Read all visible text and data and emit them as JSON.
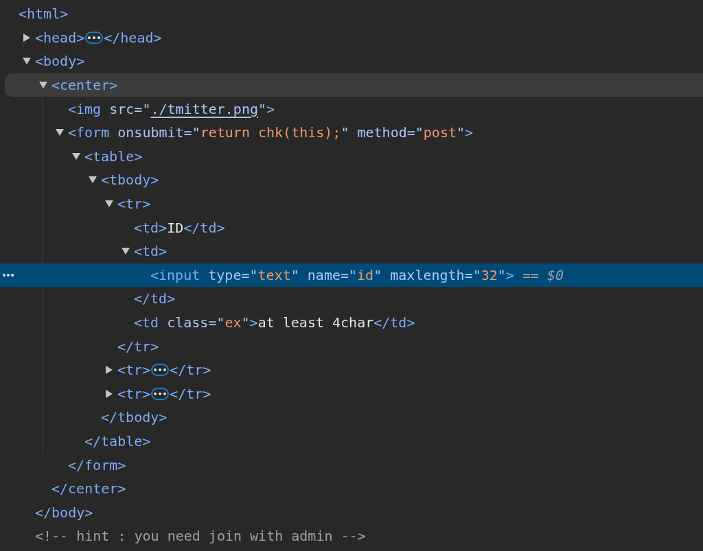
{
  "dom_tree": {
    "line": [
      {
        "kind": "tag",
        "text": "<html>"
      }
    ],
    "selected": false,
    "hovered": false,
    "children": [
      {
        "line": [
          {
            "kind": "tag",
            "text": "<head>"
          }
        ],
        "expanded": false,
        "selected": false,
        "hovered": false,
        "close": [
          {
            "kind": "tag",
            "text": "</head>"
          }
        ]
      },
      {
        "line": [
          {
            "kind": "tag",
            "text": "<body>"
          }
        ],
        "expanded": true,
        "selected": false,
        "hovered": false,
        "close": [
          {
            "kind": "tag",
            "text": "</body>"
          }
        ],
        "children": [
          {
            "line": [
              {
                "kind": "tag",
                "text": "<center>"
              }
            ],
            "expanded": true,
            "selected": false,
            "hovered": true,
            "close": [
              {
                "kind": "tag",
                "text": "</center>"
              }
            ],
            "children": [
              {
                "line": [
                  {
                    "kind": "tag",
                    "text": "<img"
                  },
                  {
                    "kind": "attr",
                    "text": " src"
                  },
                  {
                    "kind": "attr",
                    "text": "=\""
                  },
                  {
                    "kind": "link",
                    "text": "./tmitter.png"
                  },
                  {
                    "kind": "attr",
                    "text": "\""
                  },
                  {
                    "kind": "tag",
                    "text": ">"
                  }
                ],
                "selected": false,
                "hovered": false
              },
              {
                "line": [
                  {
                    "kind": "tag",
                    "text": "<form"
                  },
                  {
                    "kind": "attr",
                    "text": " onsubmit"
                  },
                  {
                    "kind": "attr",
                    "text": "=\""
                  },
                  {
                    "kind": "value",
                    "text": "return chk(this);"
                  },
                  {
                    "kind": "attr",
                    "text": "\" method"
                  },
                  {
                    "kind": "attr",
                    "text": "=\""
                  },
                  {
                    "kind": "value",
                    "text": "post"
                  },
                  {
                    "kind": "attr",
                    "text": "\""
                  },
                  {
                    "kind": "tag",
                    "text": ">"
                  }
                ],
                "expanded": true,
                "selected": false,
                "hovered": false,
                "close": [
                  {
                    "kind": "tag",
                    "text": "</form>"
                  }
                ],
                "children": [
                  {
                    "line": [
                      {
                        "kind": "tag",
                        "text": "<table>"
                      }
                    ],
                    "expanded": true,
                    "selected": false,
                    "hovered": false,
                    "close": [
                      {
                        "kind": "tag",
                        "text": "</table>"
                      }
                    ],
                    "children": [
                      {
                        "line": [
                          {
                            "kind": "tag",
                            "text": "<tbody>"
                          }
                        ],
                        "expanded": true,
                        "selected": false,
                        "hovered": false,
                        "close": [
                          {
                            "kind": "tag",
                            "text": "</tbody>"
                          }
                        ],
                        "children": [
                          {
                            "line": [
                              {
                                "kind": "tag",
                                "text": "<tr>"
                              }
                            ],
                            "expanded": true,
                            "selected": false,
                            "hovered": false,
                            "close": [
                              {
                                "kind": "tag",
                                "text": "</tr>"
                              }
                            ],
                            "children": [
                              {
                                "line": [
                                  {
                                    "kind": "tag",
                                    "text": "<td>"
                                  },
                                  {
                                    "kind": "text",
                                    "text": "ID"
                                  },
                                  {
                                    "kind": "tag",
                                    "text": "</td>"
                                  }
                                ],
                                "selected": false,
                                "hovered": false
                              },
                              {
                                "line": [
                                  {
                                    "kind": "tag",
                                    "text": "<td>"
                                  }
                                ],
                                "expanded": true,
                                "selected": false,
                                "hovered": false,
                                "close": [
                                  {
                                    "kind": "tag",
                                    "text": "</td>"
                                  }
                                ],
                                "children": [
                                  {
                                    "line": [
                                      {
                                        "kind": "tag",
                                        "text": "<input"
                                      },
                                      {
                                        "kind": "attr",
                                        "text": " type"
                                      },
                                      {
                                        "kind": "attr",
                                        "text": "=\""
                                      },
                                      {
                                        "kind": "value",
                                        "text": "text"
                                      },
                                      {
                                        "kind": "attr",
                                        "text": "\" name"
                                      },
                                      {
                                        "kind": "attr",
                                        "text": "=\""
                                      },
                                      {
                                        "kind": "value",
                                        "text": "id"
                                      },
                                      {
                                        "kind": "attr",
                                        "text": "\" maxlength"
                                      },
                                      {
                                        "kind": "attr",
                                        "text": "=\""
                                      },
                                      {
                                        "kind": "value",
                                        "text": "32"
                                      },
                                      {
                                        "kind": "attr",
                                        "text": "\""
                                      },
                                      {
                                        "kind": "tag",
                                        "text": ">"
                                      },
                                      {
                                        "kind": "ref",
                                        "text": " == "
                                      },
                                      {
                                        "kind": "var",
                                        "text": "$0"
                                      }
                                    ],
                                    "selected": true,
                                    "hovered": false
                                  }
                                ]
                              },
                              {
                                "line": [
                                  {
                                    "kind": "tag",
                                    "text": "<td"
                                  },
                                  {
                                    "kind": "attr",
                                    "text": " class"
                                  },
                                  {
                                    "kind": "attr",
                                    "text": "=\""
                                  },
                                  {
                                    "kind": "value",
                                    "text": "ex"
                                  },
                                  {
                                    "kind": "attr",
                                    "text": "\""
                                  },
                                  {
                                    "kind": "tag",
                                    "text": ">"
                                  },
                                  {
                                    "kind": "text",
                                    "text": "at least 4char"
                                  },
                                  {
                                    "kind": "tag",
                                    "text": "</td>"
                                  }
                                ],
                                "selected": false,
                                "hovered": false
                              }
                            ]
                          },
                          {
                            "line": [
                              {
                                "kind": "tag",
                                "text": "<tr>"
                              }
                            ],
                            "expanded": false,
                            "selected": false,
                            "hovered": false,
                            "close": [
                              {
                                "kind": "tag",
                                "text": "</tr>"
                              }
                            ]
                          },
                          {
                            "line": [
                              {
                                "kind": "tag",
                                "text": "<tr>"
                              }
                            ],
                            "expanded": false,
                            "selected": false,
                            "hovered": false,
                            "close": [
                              {
                                "kind": "tag",
                                "text": "</tr>"
                              }
                            ]
                          }
                        ]
                      }
                    ]
                  }
                ]
              }
            ]
          }
        ]
      },
      {
        "line": [
          {
            "kind": "comment",
            "text": "<!-- hint : you need join with admin -->"
          }
        ],
        "selected": false,
        "hovered": false
      }
    ]
  }
}
